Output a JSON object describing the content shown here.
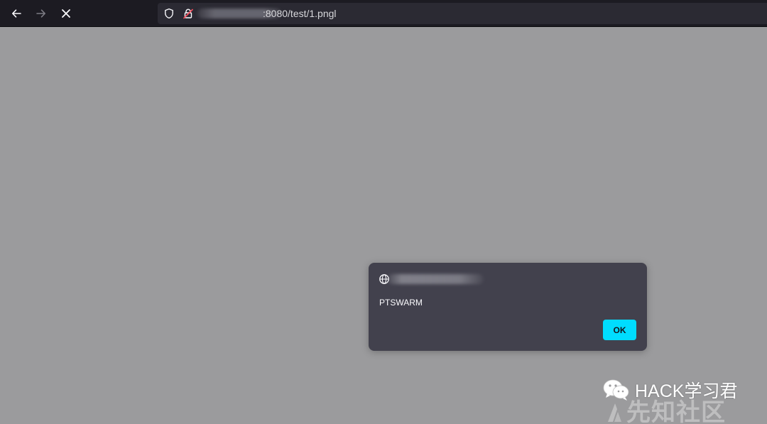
{
  "browser": {
    "url_visible_suffix": ":8080/test/1.pngl",
    "icons": {
      "back": "arrow-left-icon",
      "forward": "arrow-right-icon",
      "stop": "close-icon",
      "tracking": "shield-icon",
      "security": "insecure-lock-icon"
    },
    "colors": {
      "toolbar": "#1c1b22",
      "urlbar": "#2b2a33",
      "page": "#9b9b9d"
    }
  },
  "dialog": {
    "message": "PTSWARM",
    "ok_label": "OK",
    "origin_icon": "globe-icon",
    "colors": {
      "background": "#42414d",
      "ok_button": "#00ddff"
    }
  },
  "watermarks": {
    "social_text": "HACK学习君",
    "site_text": "先知社区",
    "icons": [
      "wechat-icon",
      "site-logo-icon"
    ]
  }
}
